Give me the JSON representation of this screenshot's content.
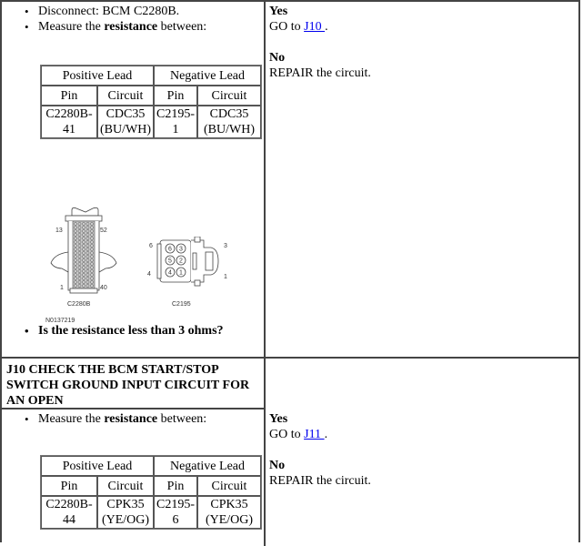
{
  "steps_j9": {
    "bullets": [
      {
        "text": "Disconnect: BCM C2280B."
      },
      {
        "prefix": "Measure the ",
        "bold": "resistance",
        "suffix": " between:"
      }
    ],
    "table": {
      "group_headers": [
        "Positive Lead",
        "Negative Lead"
      ],
      "sub_headers": [
        "Pin",
        "Circuit",
        "Pin",
        "Circuit"
      ],
      "row": [
        [
          "C2280B-",
          "41"
        ],
        [
          "CDC35",
          "(BU/WH)"
        ],
        [
          "C2195-",
          "1"
        ],
        [
          "CDC35",
          "(BU/WH)"
        ]
      ]
    },
    "diagram": {
      "connector_a": {
        "name": "C2280B",
        "pin_labels": [
          "13",
          "52",
          "1",
          "40"
        ]
      },
      "connector_b": {
        "name": "C2195",
        "pin_labels": [
          "6",
          "3",
          "4",
          "1"
        ],
        "cavities": [
          "6",
          "3",
          "5",
          "2",
          "4",
          "1"
        ]
      },
      "figure_id": "N0137219"
    },
    "question": "Is the resistance less than 3 ohms?",
    "answers": {
      "yes_label": "Yes",
      "yes_prefix": "GO to ",
      "yes_link": "J10 ",
      "yes_suffix": ".",
      "no_label": "No",
      "no_text": "REPAIR the circuit."
    }
  },
  "step_j10": {
    "heading": "J10 CHECK THE BCM START/STOP SWITCH GROUND INPUT CIRCUIT FOR AN OPEN",
    "bullets": [
      {
        "prefix": "Measure the ",
        "bold": "resistance",
        "suffix": " between:"
      }
    ],
    "table": {
      "group_headers": [
        "Positive Lead",
        "Negative Lead"
      ],
      "sub_headers": [
        "Pin",
        "Circuit",
        "Pin",
        "Circuit"
      ],
      "row": [
        [
          "C2280B-",
          "44"
        ],
        [
          "CPK35",
          "(YE/OG)"
        ],
        [
          "C2195-",
          "6"
        ],
        [
          "CPK35",
          "(YE/OG)"
        ]
      ]
    },
    "answers": {
      "yes_label": "Yes",
      "yes_prefix": "GO to ",
      "yes_link": "J11 ",
      "yes_suffix": ".",
      "no_label": "No",
      "no_text": "REPAIR the circuit."
    }
  }
}
